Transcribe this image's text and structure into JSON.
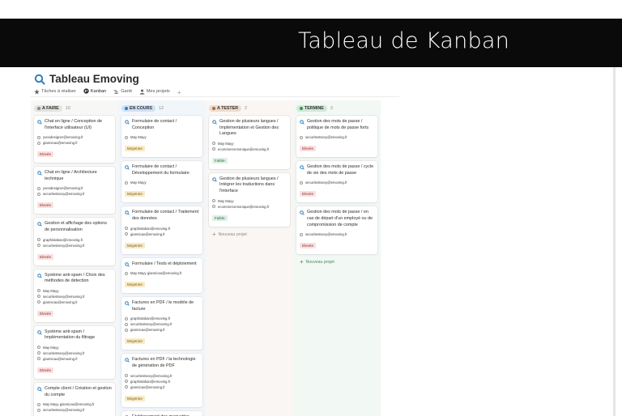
{
  "slide": {
    "title": "Tableau de Kanban"
  },
  "app": {
    "title": "Tableau Emoving",
    "views": [
      {
        "label": "Tâches à réaliser",
        "icon": "star-icon"
      },
      {
        "label": "Kanban",
        "icon": "kanban-icon"
      },
      {
        "label": "Gantt",
        "icon": "gantt-icon"
      },
      {
        "label": "Mes projets",
        "icon": "person-icon"
      }
    ],
    "add_view": "+"
  },
  "colors": {
    "todo": "#eeeeec",
    "doing": "#e2ecf7",
    "test": "#f6ece6",
    "done": "#e6f1e8",
    "accent": "#2f80c0"
  },
  "columns": [
    {
      "label": "A FAIRE",
      "count": "10",
      "cards": [
        {
          "title": "Chat en ligne / Conception de l'interface utilisateur (UI)",
          "people": [
            "yvesdesigner@emoving.fr",
            "giannicao@emoving.fr"
          ],
          "tag": "Elevée"
        },
        {
          "title": "Chat en ligne / Architecture technique",
          "people": [
            "yvesdesigner@emoving.fr",
            "securitestsexy@emoving.fr"
          ],
          "tag": "Elevée"
        },
        {
          "title": "Gestion et affichage des options de personnalisation",
          "people": [
            "graphistaban@emoving.fr",
            "securitestsexy@emoving.fr"
          ],
          "tag": "Elevée"
        },
        {
          "title": "Système anti-spam / Choix des méthodes de détection",
          "people": [
            "May Mayy",
            "securitestsexy@emoving.fr",
            "giannicao@emoving.fr"
          ],
          "tag": "Elevée"
        },
        {
          "title": "Système anti-spam / Implémentation du filtrage",
          "people": [
            "May Mayy",
            "securitestsexy@emoving.fr",
            "giannicao@emoving.fr"
          ],
          "tag": "Elevée"
        },
        {
          "title": "Compte client / Création et gestion du compte",
          "people": [
            "May Mayy   giannicao@emoving.fr",
            "securitestsexy@emoving.fr"
          ],
          "tag": "Elevée"
        }
      ]
    },
    {
      "label": "EN COURS",
      "count": "12",
      "cards": [
        {
          "title": "Formulaire de contact / Conception",
          "people": [
            "May Mayy"
          ],
          "tag": "Moyenne"
        },
        {
          "title": "Formulaire de contact / Développement du formulaire",
          "people": [
            "May Mayy"
          ],
          "tag": "Moyenne"
        },
        {
          "title": "Formulaire de contact / Traitement des données",
          "people": [
            "graphistaban@emoving.fr",
            "giannicao@emoving.fr"
          ],
          "tag": "Moyenne"
        },
        {
          "title": "Formulaire / Tests et déploiement",
          "people": [
            "May Mayy   giannicao@emoving.fr"
          ],
          "tag": "Moyenne"
        },
        {
          "title": "Factures en PDF / le modèle de facture",
          "people": [
            "graphistaban@emoving.fr",
            "securitestsexy@emoving.fr",
            "giannicao@emoving.fr"
          ],
          "tag": "Moyenne"
        },
        {
          "title": "Factures en PDF / la technologie de génération de PDF",
          "people": [
            "securitestsexy@emoving.fr",
            "graphistaban@emoving.fr",
            "giannicao@emoving.fr"
          ],
          "tag": "Moyenne"
        },
        {
          "title": "Etablissement des maquettes d'après wireframe",
          "people": [],
          "tag": ""
        }
      ]
    },
    {
      "label": "A TESTER",
      "count": "2",
      "cards": [
        {
          "title": "Gestion de plusieurs langues / Implémentation et Gestion des Langues",
          "people": [
            "May Mayy",
            "ecommercemonique@emoving.fr"
          ],
          "tag": "Faible"
        },
        {
          "title": "Gestion de plusieurs langues / Intégrer les traductions dans l'interface",
          "people": [
            "May Mayy",
            "ecommercemonique@emoving.fr"
          ],
          "tag": "Faible"
        }
      ],
      "add_label": "Nouveau projet"
    },
    {
      "label": "TERMINE",
      "count": "3",
      "cards": [
        {
          "title": "Gestion des mots de passe / politique de mots de passe forts",
          "people": [
            "securitestsexy@emoving.fr"
          ],
          "tag": "Elevée"
        },
        {
          "title": "Gestion des mots de passe / cycle de vie des mots de passe",
          "people": [
            "securitestsexy@emoving.fr"
          ],
          "tag": "Elevée"
        },
        {
          "title": "Gestion des mots de passe / en cas de départ d'un employé ou de compromission de compte",
          "people": [
            "securitestsexy@emoving.fr"
          ],
          "tag": "Elevée"
        }
      ],
      "add_label": "Nouveau projet"
    }
  ]
}
